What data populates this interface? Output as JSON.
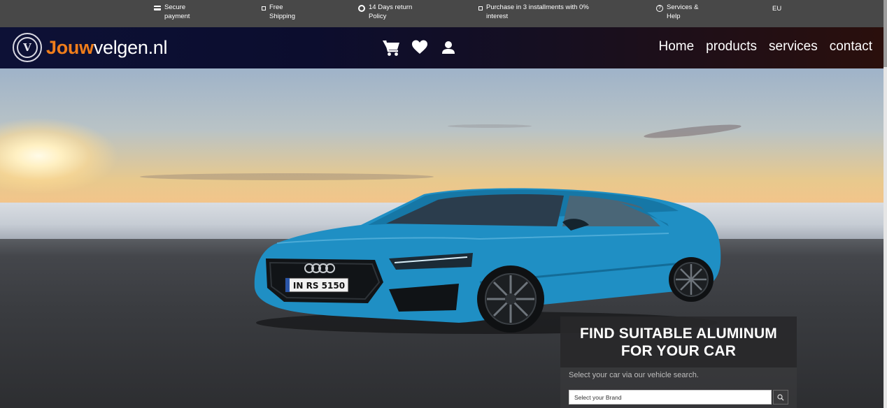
{
  "topbar": {
    "items": [
      {
        "label": "Secure\npayment",
        "icon": "credit-card-icon"
      },
      {
        "label": "Free\nShipping",
        "icon": "truck-icon"
      },
      {
        "label": "14 Days return\nPolicy",
        "icon": "return-icon"
      },
      {
        "label": "Purchase in 3 installments with 0%\ninterest",
        "icon": "installments-icon"
      },
      {
        "label": "Services &\nHelp",
        "icon": "help-icon"
      }
    ],
    "language": {
      "label": "EU",
      "icon": "netherlands-flag-icon"
    }
  },
  "header": {
    "logo": {
      "part1": "Jouw",
      "part2": "velgen.nl",
      "mark": "V"
    },
    "icons": [
      "cart-icon",
      "heart-icon",
      "user-icon"
    ],
    "nav": [
      {
        "label": "Home"
      },
      {
        "label": "products"
      },
      {
        "label": "services"
      },
      {
        "label": "contact"
      }
    ]
  },
  "hero": {
    "plate": "IN RS 5150",
    "panel": {
      "title_line1": "FIND SUITABLE ALUMINUM",
      "title_line2": "FOR YOUR CAR",
      "subtitle": "Select your car via our vehicle search.",
      "brand_placeholder": "Select your Brand",
      "search_icon": "search-icon"
    }
  },
  "colors": {
    "accent": "#ef7d1b",
    "topbar": "#484848",
    "header_start": "#0d1136",
    "header_end": "#2a0f0c",
    "car": "#1f8fc4"
  }
}
